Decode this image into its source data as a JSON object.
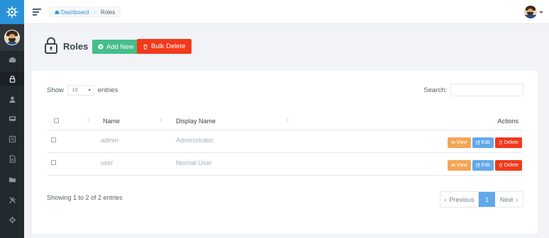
{
  "breadcrumb": {
    "home": "Dashboard",
    "current": "Roles"
  },
  "page": {
    "title": "Roles",
    "add_label": "Add New",
    "bulk_label": "Bulk Delete"
  },
  "table_controls": {
    "show_label": "Show",
    "entries_value": "10",
    "entries_label": "entries",
    "search_label": "Search:"
  },
  "columns": {
    "name": "Name",
    "display_name": "Display Name",
    "actions": "Actions"
  },
  "rows": [
    {
      "name": "admin",
      "display_name": "Administrator"
    },
    {
      "name": "user",
      "display_name": "Normal User"
    }
  ],
  "row_actions": {
    "view": "View",
    "edit": "Edit",
    "delete": "Delete"
  },
  "footer": {
    "info": "Showing 1 to 2 of 2 entries",
    "prev": "Previous",
    "page": "1",
    "next": "Next"
  },
  "colors": {
    "brand": "#2a92d8",
    "sidebar": "#22292f",
    "add": "#46be8a",
    "danger": "#f2391b",
    "view": "#f2a654",
    "edit": "#62a8ea"
  },
  "icons": {
    "sidebar": [
      "dashboard-icon",
      "lock-icon",
      "user-icon",
      "inbox-icon",
      "document-icon",
      "file-icon",
      "folder-icon",
      "tools-icon",
      "settings-icon"
    ]
  }
}
